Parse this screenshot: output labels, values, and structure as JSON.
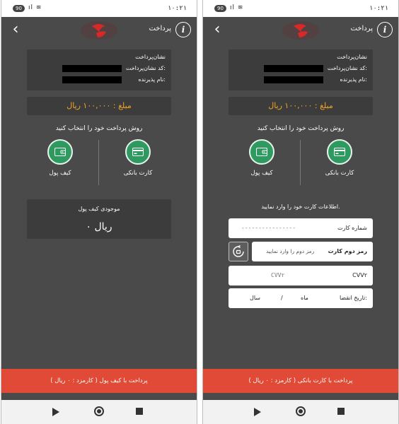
{
  "status": {
    "time": "۱۰:۲۱",
    "battery": "90"
  },
  "header": {
    "title": "پرداخت"
  },
  "merchant": {
    "title": "نشان‌پرداخت",
    "code_label": "کد نشان‌پرداخت:",
    "name_label": "نام پذیرنده:"
  },
  "amount": {
    "text": "مبلغ : ۱۰۰,۰۰۰ ریال"
  },
  "choose_method": "روش پرداخت خود را انتخاب کنید",
  "methods": [
    {
      "label": "کارت بانکی",
      "icon": "card-icon"
    },
    {
      "label": "کیف پول",
      "icon": "wallet-icon"
    }
  ],
  "wallet": {
    "title": "موجودی کیف پول",
    "balance": "۰ ریال"
  },
  "left_pay": {
    "label": "پرداخت با کیف پول ( کارمزد : ۰ ریال )"
  },
  "card_form": {
    "instruction": "اطلاعات کارت خود را وارد نمایید.",
    "card_number_label": "شماره کارت",
    "card_number_value": "----------------",
    "second_pin_label": "رمز دوم کارت",
    "second_pin_placeholder": "رمز دوم را وارد نمایید",
    "cvv2_label": "CVV۲",
    "cvv2_placeholder": "CVV۲",
    "expiry_label": "تاریخ انقضا:",
    "expiry_month": "ماه",
    "expiry_sep": "/",
    "expiry_year": "سال"
  },
  "right_pay": {
    "label": "پرداخت با کارت بانکی ( کارمزد : ۰ ریال )"
  },
  "colors": {
    "accent_green": "#2f9a5f",
    "amount_orange": "#f5a623",
    "pay_red": "#e04a36"
  }
}
